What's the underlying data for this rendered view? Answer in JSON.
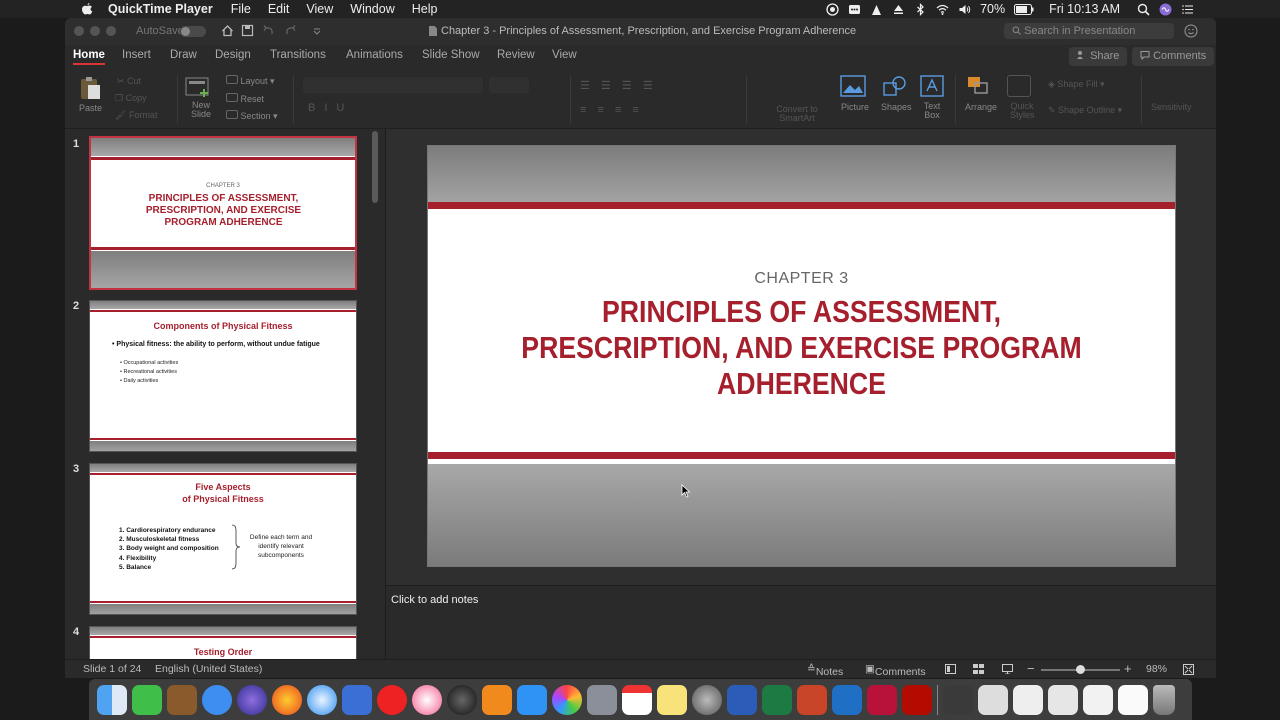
{
  "menubar": {
    "app": "QuickTime Player",
    "items": [
      "File",
      "Edit",
      "View",
      "Window",
      "Help"
    ],
    "battery": "70%",
    "clock": "Fri 10:13 AM"
  },
  "window": {
    "autosave": "AutoSave",
    "title": "Chapter 3 - Principles of Assessment, Prescription, and Exercise Program Adherence",
    "search_placeholder": "Search in Presentation"
  },
  "tabs": [
    "Home",
    "Insert",
    "Draw",
    "Design",
    "Transitions",
    "Animations",
    "Slide Show",
    "Review",
    "View"
  ],
  "share": "Share",
  "comments": "Comments",
  "ribbon": {
    "paste": "Paste",
    "cut": "Cut",
    "copy": "Copy",
    "format": "Format",
    "new_slide": "New Slide",
    "layout": "Layout",
    "reset": "Reset",
    "section": "Section",
    "convert": "Convert to SmartArt",
    "picture": "Picture",
    "shapes": "Shapes",
    "textbox": "Text Box",
    "arrange": "Arrange",
    "quick_styles": "Quick Styles",
    "shape_fill": "Shape Fill",
    "shape_outline": "Shape Outline",
    "sensitivity": "Sensitivity"
  },
  "thumbs": [
    {
      "num": "1",
      "sub": "CHAPTER 3",
      "title": "PRINCIPLES OF ASSESSMENT, PRESCRIPTION, AND EXERCISE PROGRAM ADHERENCE"
    },
    {
      "num": "2",
      "title": "Components of Physical Fitness",
      "bullet": "Physical fitness: the ability to perform, without undue fatigue",
      "subs": [
        "Occupational activities",
        "Recreational activities",
        "Daily activities"
      ]
    },
    {
      "num": "3",
      "title1": "Five Aspects",
      "title2": "of Physical Fitness",
      "items": [
        "1.  Cardiorespiratory endurance",
        "2.  Musculoskeletal fitness",
        "3.  Body weight and composition",
        "4.  Flexibility",
        "5.  Balance"
      ],
      "note": "Define each term and identify relevant subcomponents"
    },
    {
      "num": "4",
      "title": "Testing Order"
    }
  ],
  "slide": {
    "chapter": "CHAPTER 3",
    "title_lines": [
      "PRINCIPLES OF ASSESSMENT,",
      "PRESCRIPTION, AND EXERCISE PROGRAM",
      "ADHERENCE"
    ]
  },
  "notes": "Click to add notes",
  "status": {
    "slide": "Slide 1 of 24",
    "lang": "English (United States)",
    "notes": "Notes",
    "comments": "Comments",
    "zoom": "98%"
  },
  "colors": {
    "accent": "#a51f2d"
  }
}
